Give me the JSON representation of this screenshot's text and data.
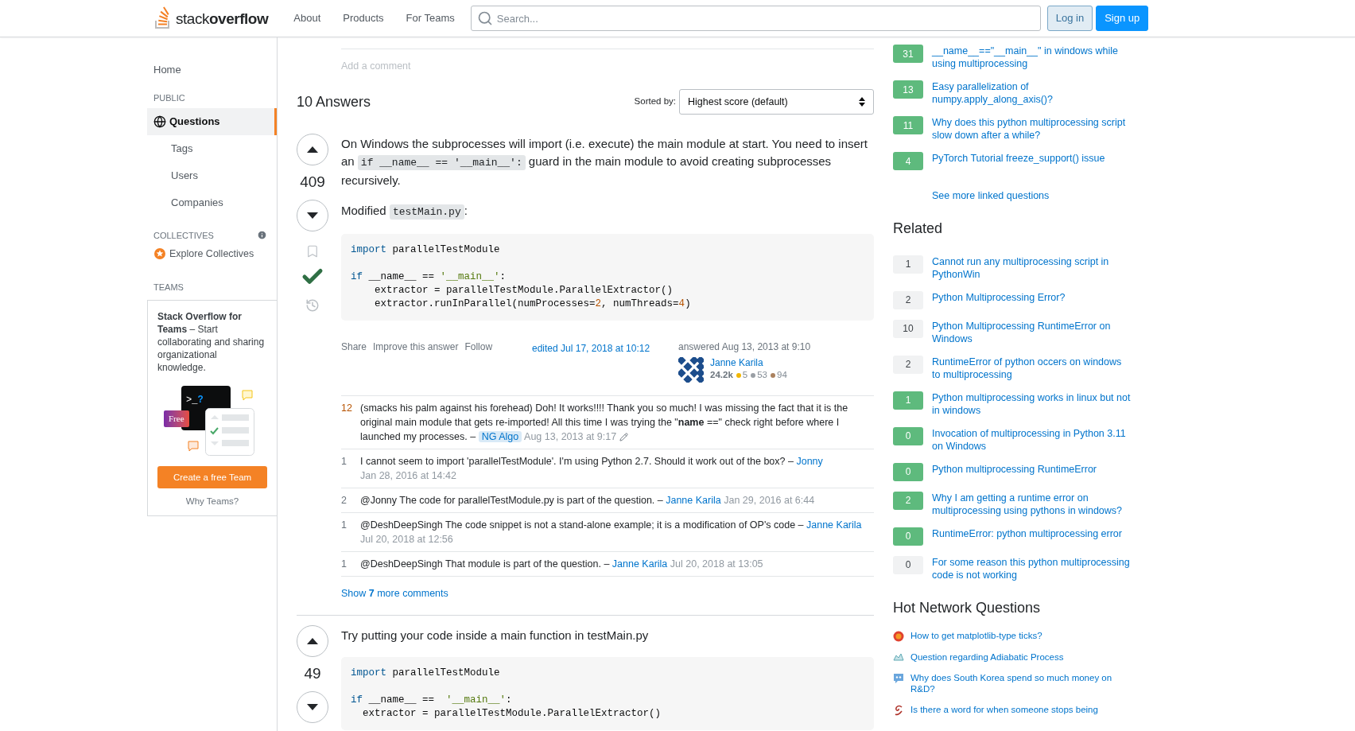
{
  "header": {
    "logo": {
      "light": "stack",
      "bold": "overflow"
    },
    "nav": [
      "About",
      "Products",
      "For Teams"
    ],
    "search": {
      "placeholder": "Search..."
    },
    "buttons": [
      {
        "kind": "secondary",
        "label": "Log in"
      },
      {
        "kind": "primary",
        "label": "Sign up"
      }
    ]
  },
  "sidebar": {
    "home": {
      "label": "Home",
      "selected": false
    },
    "public": {
      "heading": "PUBLIC",
      "items": [
        {
          "label": "Questions",
          "selected": true
        },
        {
          "label": "Tags",
          "selected": false
        },
        {
          "label": "Users",
          "selected": false
        },
        {
          "label": "Companies",
          "selected": false
        }
      ]
    },
    "collectives": {
      "heading": "COLLECTIVES",
      "link": "Explore Collectives"
    },
    "teams": {
      "heading": "TEAMS",
      "card": {
        "text": "**Stack Overflow for Teams** – Start collaborating and sharing organizational knowledge.",
        "prompt": ">_",
        "mark": "?",
        "badge": "Free",
        "button": "Create a free Team",
        "link": "Why Teams?"
      }
    }
  },
  "question": {
    "add_comment": "Add a comment"
  },
  "answers_header": {
    "count": "10 Answers",
    "sort_label": "Sorted by:",
    "sort_value": "Highest score (default)"
  },
  "answers": [
    {
      "score": "409",
      "accepted": true,
      "body": [
        {
          "kind": "paragraph",
          "parts": [
            {
              "kind": "text",
              "text": "On Windows the subprocesses will import (i.e. execute) the main module at start. You need to insert an "
            },
            {
              "kind": "code",
              "text": "if __name__ == '__main__':"
            },
            {
              "kind": "text",
              "text": " guard in the main module to avoid creating subprocesses recursively."
            }
          ]
        },
        {
          "kind": "paragraph",
          "parts": [
            {
              "kind": "text",
              "text": "Modified "
            },
            {
              "kind": "code",
              "text": "testMain.py"
            },
            {
              "kind": "text",
              "text": ":"
            }
          ]
        },
        {
          "kind": "code_block",
          "lines": [
            {
              "kind": "code",
              "tokens": [
                {
                  "kind": "keyword",
                  "text": "import"
                },
                {
                  "kind": "plain",
                  "text": " parallelTestModule"
                }
              ]
            },
            {
              "kind": "blank"
            },
            {
              "kind": "code",
              "tokens": [
                {
                  "kind": "keyword",
                  "text": "if"
                },
                {
                  "kind": "plain",
                  "text": " __name__ == "
                },
                {
                  "kind": "string",
                  "text": "'__main__'"
                },
                {
                  "kind": "plain",
                  "text": ":"
                }
              ]
            },
            {
              "kind": "code",
              "tokens": [
                {
                  "kind": "plain",
                  "text": "    extractor = parallelTestModule.ParallelExtractor()"
                }
              ]
            },
            {
              "kind": "code",
              "tokens": [
                {
                  "kind": "plain",
                  "text": "    extractor.runInParallel(numProcesses="
                },
                {
                  "kind": "number",
                  "text": "2"
                },
                {
                  "kind": "plain",
                  "text": ", numThreads="
                },
                {
                  "kind": "number",
                  "text": "4"
                },
                {
                  "kind": "plain",
                  "text": ")"
                }
              ]
            }
          ]
        }
      ],
      "menu": [
        "Share",
        "Improve this answer",
        "Follow"
      ],
      "edited": "edited Jul 17, 2018 at 10:12",
      "answered": "answered Aug 13, 2013 at 9:10",
      "user": {
        "name": "Janne Karila",
        "rep": "24.2k",
        "gold": "5",
        "silver": "53",
        "bronze": "94"
      },
      "comments": [
        {
          "score": "12",
          "popular": true,
          "text": "(smacks his palm against his forehead) Doh! It works!!!! Thank you so much! I was missing the fact that it is the original main module that gets re-imported! All this time I was trying the \"**name** ==\" check right before where I launched my processes. –",
          "user": "NG Algo",
          "user_is_op": true,
          "date": "Aug 13, 2013 at 9:17",
          "edited": true
        },
        {
          "score": "1",
          "popular": false,
          "text": "I cannot seem to import 'parallelTestModule'. I'm using Python 2.7. Should it work out of the box? –",
          "user": "Jonny",
          "user_is_op": false,
          "date": "Jan 28, 2016 at 14:42",
          "edited": false
        },
        {
          "score": "2",
          "popular": false,
          "text": "@Jonny The code for parallelTestModule.py is part of the question. –",
          "user": "Janne Karila",
          "user_is_op": false,
          "date": "Jan 29, 2016 at 6:44",
          "edited": false
        },
        {
          "score": "1",
          "popular": false,
          "text": "@DeshDeepSingh The code snippet is not a stand-alone example; it is a modification of OP's code –",
          "user": "Janne Karila",
          "user_is_op": false,
          "date": "Jul 20, 2018 at 12:56",
          "edited": false
        },
        {
          "score": "1",
          "popular": false,
          "text": "@DeshDeepSingh That module is part of the question. –",
          "user": "Janne Karila",
          "user_is_op": false,
          "date": "Jul 20, 2018 at 13:05",
          "edited": false
        }
      ],
      "show_more": "Show **7** more comments"
    },
    {
      "score": "49",
      "accepted": false,
      "body": [
        {
          "kind": "paragraph",
          "parts": [
            {
              "kind": "text",
              "text": "Try putting your code inside a main function in testMain.py"
            }
          ]
        },
        {
          "kind": "code_block",
          "lines": [
            {
              "kind": "code",
              "tokens": [
                {
                  "kind": "keyword",
                  "text": "import"
                },
                {
                  "kind": "plain",
                  "text": " parallelTestModule"
                }
              ]
            },
            {
              "kind": "blank"
            },
            {
              "kind": "code",
              "tokens": [
                {
                  "kind": "keyword",
                  "text": "if"
                },
                {
                  "kind": "plain",
                  "text": " __name__ ==  "
                },
                {
                  "kind": "string",
                  "text": "'__main__'"
                },
                {
                  "kind": "plain",
                  "text": ":"
                }
              ]
            },
            {
              "kind": "code",
              "tokens": [
                {
                  "kind": "plain",
                  "text": "  extractor = parallelTestModule.ParallelExtractor()"
                }
              ]
            }
          ]
        }
      ]
    }
  ],
  "linked": {
    "items": [
      {
        "score": "31",
        "answered": true,
        "title": "__name__==\"__main__\" in windows while using multiprocessing"
      },
      {
        "score": "13",
        "answered": true,
        "title": "Easy parallelization of numpy.apply_along_axis()?"
      },
      {
        "score": "11",
        "answered": true,
        "title": "Why does this python multiprocessing script slow down after a while?"
      },
      {
        "score": "4",
        "answered": true,
        "title": "PyTorch Tutorial freeze_support() issue"
      }
    ],
    "more": "See more linked questions"
  },
  "related": {
    "title": "Related",
    "items": [
      {
        "score": "1",
        "answered": false,
        "title": "Cannot run any multiprocessing script in PythonWin"
      },
      {
        "score": "2",
        "answered": false,
        "title": "Python Multiprocessing Error?"
      },
      {
        "score": "10",
        "answered": false,
        "title": "Python Multiprocessing RuntimeError on Windows"
      },
      {
        "score": "2",
        "answered": false,
        "title": "RuntimeError of python occers on windows to multiprocessing"
      },
      {
        "score": "1",
        "answered": true,
        "title": "Python multiprocessing works in linux but not in windows"
      },
      {
        "score": "0",
        "answered": true,
        "title": "Invocation of multiprocessing in Python 3.11 on Windows"
      },
      {
        "score": "0",
        "answered": true,
        "title": "Python multiprocessing RuntimeError"
      },
      {
        "score": "2",
        "answered": true,
        "title": "Why I am getting a runtime error on multiprocessing using pythons in windows?"
      },
      {
        "score": "0",
        "answered": true,
        "title": "RuntimeError: python multiprocessing error"
      },
      {
        "score": "0",
        "answered": false,
        "title": "For some reason this python multiprocessing code is not working"
      }
    ]
  },
  "hot": {
    "title": "Hot Network Questions",
    "items": [
      "How to get matplotlib-type ticks?",
      "Question regarding Adiabatic Process",
      "Why does South Korea spend so much money on R&D?",
      "Is there a word for when someone stops being"
    ]
  }
}
